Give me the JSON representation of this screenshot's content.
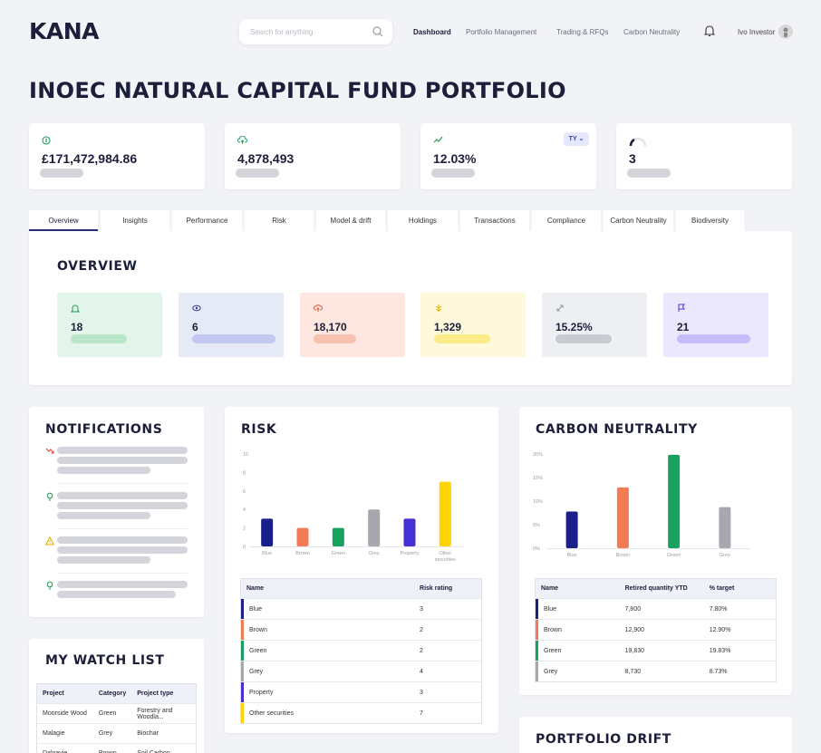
{
  "header": {
    "logo": "KANA",
    "search_placeholder": "Search for anything",
    "nav": [
      "Dashboard",
      "Portfolio Management",
      "Trading & RFQs",
      "Carbon Neutrality"
    ],
    "user_name": "Ivo Investor"
  },
  "page_title": "INOEC NATURAL CAPITAL FUND PORTFOLIO",
  "kpis": [
    {
      "value": "£171,472,984.86",
      "icon": "coin-icon"
    },
    {
      "value": "4,878,493",
      "icon": "cloud-upload-icon"
    },
    {
      "value": "12.03%",
      "icon": "trend-up-icon",
      "badge": "TY"
    },
    {
      "value": "3",
      "icon": "gauge-icon"
    }
  ],
  "tabs": [
    "Overview",
    "Insights",
    "Performance",
    "Risk",
    "Model & drift",
    "Holdings",
    "Transactions",
    "Compliance",
    "Carbon Neutrality",
    "Biodiversity"
  ],
  "overview": {
    "title": "OVERVIEW",
    "items": [
      {
        "value": "18",
        "icon": "bell-icon",
        "bg": "#e3f5ea",
        "bar": "#b9e5c9",
        "fg": "#1e9c55"
      },
      {
        "value": "6",
        "icon": "eye-icon",
        "bg": "#e6e9f6",
        "bar": "#c2c8ef",
        "fg": "#2c3590"
      },
      {
        "value": "18,170",
        "icon": "cloud-upload-icon",
        "bg": "#fde7e0",
        "bar": "#f9c1b0",
        "fg": "#e0583a"
      },
      {
        "value": "1,329",
        "icon": "leaf-icon",
        "bg": "#fff9dc",
        "bar": "#fbea88",
        "fg": "#d9b800"
      },
      {
        "value": "15.25%",
        "icon": "expand-icon",
        "bg": "#eeeff2",
        "bar": "#c9cbd2",
        "fg": "#9a9ca5"
      },
      {
        "value": "21",
        "icon": "flag-icon",
        "bg": "#ebe7fd",
        "bar": "#c7bbf9",
        "fg": "#4b36d6"
      }
    ]
  },
  "notifications": {
    "title": "NOTIFICATIONS",
    "items": [
      {
        "icon": "trend-down-icon",
        "color": "#d93a2b"
      },
      {
        "icon": "bulb-icon",
        "color": "#1e9c55"
      },
      {
        "icon": "warning-icon",
        "color": "#e8a800"
      },
      {
        "icon": "bulb-icon",
        "color": "#1e9c55"
      }
    ]
  },
  "watchlist": {
    "title": "MY WATCH LIST",
    "columns": [
      "Project",
      "Category",
      "Project type"
    ],
    "rows": [
      [
        "Moorside Wood",
        "Green",
        "Forestry and Woodla..."
      ],
      [
        "Malagie",
        "Grey",
        "Biochar"
      ],
      [
        "Dalgavie",
        "Brown",
        "Soil Carbon"
      ]
    ]
  },
  "risk": {
    "title": "RISK",
    "chart_data": {
      "type": "bar",
      "categories": [
        "Blue",
        "Brown",
        "Green",
        "Grey",
        "Property",
        "Other securities"
      ],
      "values": [
        3,
        2,
        2,
        4,
        3,
        7
      ],
      "colors": [
        "#1b1f8a",
        "#f27a55",
        "#18a15f",
        "#a6a8ae",
        "#4530d6",
        "#ffd400"
      ],
      "ylim": [
        0,
        10
      ],
      "yticks": [
        "0",
        "2",
        "4",
        "6",
        "8",
        "10"
      ],
      "ylabel": "",
      "xlabel": "",
      "grid": false
    },
    "table": {
      "columns": [
        "Name",
        "Risk rating"
      ],
      "rows": [
        [
          "Blue",
          "3"
        ],
        [
          "Brown",
          "2"
        ],
        [
          "Green",
          "2"
        ],
        [
          "Grey",
          "4"
        ],
        [
          "Property",
          "3"
        ],
        [
          "Other securities",
          "7"
        ]
      ]
    }
  },
  "carbon": {
    "title": "CARBON NEUTRALITY",
    "chart_data": {
      "type": "bar",
      "categories": [
        "Blue",
        "Brown",
        "Green",
        "Grey"
      ],
      "values": [
        7.8,
        12.9,
        19.83,
        8.73
      ],
      "colors": [
        "#1b1f8a",
        "#f27a55",
        "#18a15f",
        "#a6a8ae"
      ],
      "ylim": [
        0,
        20
      ],
      "yticks": [
        "0%",
        "5%",
        "10%",
        "15%",
        "20%"
      ],
      "ylabel": "",
      "xlabel": "",
      "grid": false
    },
    "table": {
      "columns": [
        "Name",
        "Retired quantity YTD",
        "% target"
      ],
      "rows": [
        [
          "Blue",
          "7,800",
          "7.80%"
        ],
        [
          "Brown",
          "12,900",
          "12.90%"
        ],
        [
          "Green",
          "19,830",
          "19.83%"
        ],
        [
          "Grey",
          "8,730",
          "8.73%"
        ]
      ]
    }
  },
  "drift": {
    "title": "PORTFOLIO DRIFT"
  }
}
